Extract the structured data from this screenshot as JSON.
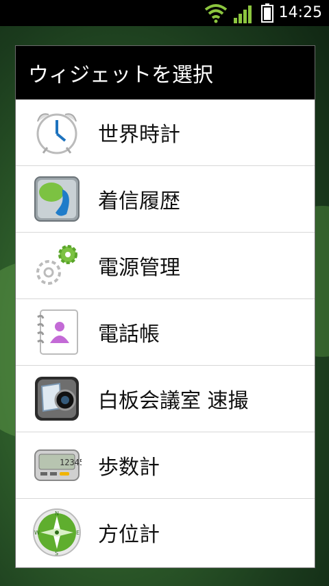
{
  "status_bar": {
    "time": "14:25",
    "wifi_icon": "wifi-icon",
    "signal_icon": "signal-icon",
    "battery_icon": "battery-icon",
    "accent_color": "#8cc63f"
  },
  "dialog": {
    "title": "ウィジェットを選択",
    "items": [
      {
        "label": "世界時計",
        "icon": "alarm-clock-icon"
      },
      {
        "label": "着信履歴",
        "icon": "call-history-icon"
      },
      {
        "label": "電源管理",
        "icon": "gear-icon"
      },
      {
        "label": "電話帳",
        "icon": "contacts-icon"
      },
      {
        "label": "白板会議室 速撮",
        "icon": "camera-icon"
      },
      {
        "label": "歩数計",
        "icon": "pedometer-icon"
      },
      {
        "label": "方位計",
        "icon": "compass-icon"
      }
    ]
  }
}
